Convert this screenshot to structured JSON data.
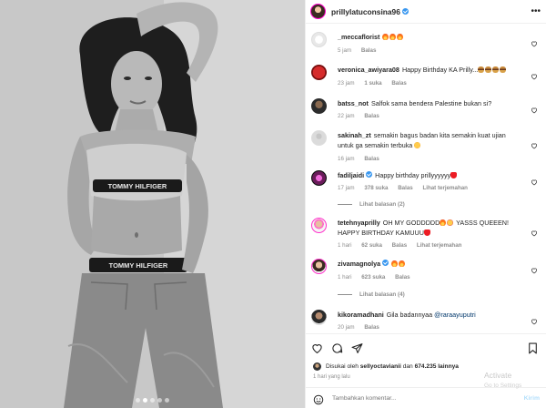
{
  "post": {
    "author": "prillylatuconsina96",
    "verified": true,
    "more_icon": "ellipsis-icon",
    "photo_count": 5,
    "active_photo": 2
  },
  "comments": [
    {
      "user": "_meccaflorist",
      "text": "",
      "emojis": [
        "fire",
        "fire",
        "fire"
      ],
      "time": "5 jam",
      "likes": "",
      "reply": "Balas",
      "translate": "",
      "view_replies": ""
    },
    {
      "user": "veronica_awiyara08",
      "text": "Happy Birthday KA Prilly...",
      "emojis": [
        "burger",
        "burger",
        "burger",
        "burger"
      ],
      "time": "23 jam",
      "likes": "1 suka",
      "reply": "Balas",
      "translate": "",
      "view_replies": ""
    },
    {
      "user": "batss_not",
      "text": "Salfok sama bendera Palestine bukan si?",
      "emojis": [],
      "time": "22 jam",
      "likes": "",
      "reply": "Balas",
      "translate": "",
      "view_replies": ""
    },
    {
      "user": "sakinah_zt",
      "text": "semakin bagus badan kita semakin kuat ujian untuk ga semakin terbuka",
      "emojis": [
        "smile"
      ],
      "time": "16 jam",
      "likes": "",
      "reply": "Balas",
      "translate": "",
      "view_replies": ""
    },
    {
      "user": "fadiljaidi",
      "text": "Happy birthday prillyyyyyy",
      "emojis": [
        "heart"
      ],
      "time": "17 jam",
      "likes": "378 suka",
      "reply": "Balas",
      "translate": "Lihat terjemahan",
      "view_replies": "Lihat balasan (2)"
    },
    {
      "user": "tetehnyaprilly",
      "text": "OH MY GODDDDD",
      "text2": "YASSS QUEEEN! HAPPY BIRTHDAY KAMUUU",
      "emojis": [
        "fire",
        "hearteyes"
      ],
      "emojis2": [
        "heart"
      ],
      "time": "1 hari",
      "likes": "62 suka",
      "reply": "Balas",
      "translate": "Lihat terjemahan",
      "view_replies": ""
    },
    {
      "user": "zivamagnolya",
      "text": "",
      "emojis": [
        "fire",
        "fire"
      ],
      "time": "1 hari",
      "likes": "623 suka",
      "reply": "Balas",
      "translate": "",
      "view_replies": "Lihat balasan (4)"
    },
    {
      "user": "kikoramadhani",
      "text": "Gila badannyaa",
      "mention": "@raraayuputri",
      "emojis": [],
      "time": "20 jam",
      "likes": "",
      "reply": "Balas",
      "translate": "",
      "view_replies": ""
    }
  ],
  "actions": {
    "like_icon": "heart-icon",
    "comment_icon": "comment-icon",
    "share_icon": "share-icon",
    "save_icon": "bookmark-icon",
    "liked_by_prefix": "Disukai oleh",
    "liked_by_user": "sellyoctavianii",
    "liked_by_and": "dan",
    "liked_by_count": "674.235 lainnya",
    "timestamp": "1 hari yang lalu",
    "emoji_icon": "emoji-icon",
    "comment_placeholder": "Tambahkan komentar...",
    "post_label": "Kirim"
  },
  "watermark": {
    "line1": "Activate",
    "line2": "Go to Settings"
  },
  "colors": {
    "verified": "#3897f0",
    "text": "#262626",
    "muted": "#8e8e8e",
    "border": "#efefef",
    "heart_emoji": "#ed1c24"
  }
}
